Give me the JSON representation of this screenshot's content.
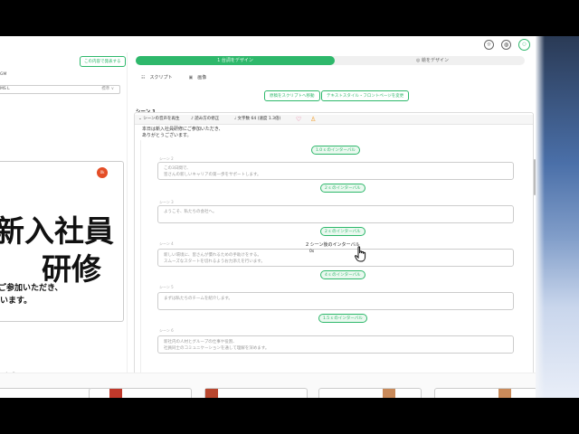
{
  "left": {
    "sync_button": "この内容で発表する",
    "lang_label": "GM",
    "voice_select": "MS L",
    "voice_select_right": "標準 ∨",
    "rec_badge": "0k",
    "slide_title_1": "新入社員",
    "slide_title_2": "研修",
    "caption_1": "ご参加いただき、",
    "caption_2": "います。",
    "pager_prev": "‹",
    "pager_next": "»"
  },
  "main": {
    "tabs": [
      "1 台詞をデザイン",
      "◎ 絵をデザイン"
    ],
    "subtabs": [
      {
        "icon": "☷",
        "label": "スクリプト"
      },
      {
        "icon": "▣",
        "label": "画像"
      }
    ],
    "btn_export": "原稿をスクリプトへ移動",
    "btn_style": "テキストスタイル・フロントページを変更",
    "scene_title": "シーン 1",
    "toolbar": {
      "toggle": "⌄ シーンの音声を再生",
      "voice": "♪ 読み方の修正",
      "speed": "♩ 文字数 64 (速度 1.3倍)",
      "heart": "♡",
      "person": "♙"
    },
    "scene_text_1": "本日は新入社員研修にご参加いただき、",
    "scene_text_2": "ありがとうございます。",
    "intervals": [
      "1.0 s のインターバル",
      "2 s のインターバル",
      "2 s のインターバル",
      "4 s のインターバル",
      "1.5 s のインターバル"
    ],
    "scene_labels": [
      "シーン 2",
      "シーン 3",
      "シーン 4",
      "シーン 5",
      "シーン 6"
    ],
    "scene_boxes": [
      "この3日間で、\n皆さんの新しいキャリアの第一歩をサポートします。",
      "ようこそ、私たちの会社へ。",
      "新しい環境に、皆さんが慣れるための手助けをする。\nスムーズなスタートを切れるようお力添えを行います。",
      "まずは私たちのチームを紹介します。",
      "新社内の人材とグループの仕事や役割、\n社員同士のコミュニケーションを通して理解を深めます。"
    ],
    "tooltip_title": "2 シーン後のインターバル",
    "tooltip_value": "0s"
  },
  "colors": {
    "accent": "#2eb86b",
    "rec": "#e44d26",
    "heart": "#e0457b"
  }
}
